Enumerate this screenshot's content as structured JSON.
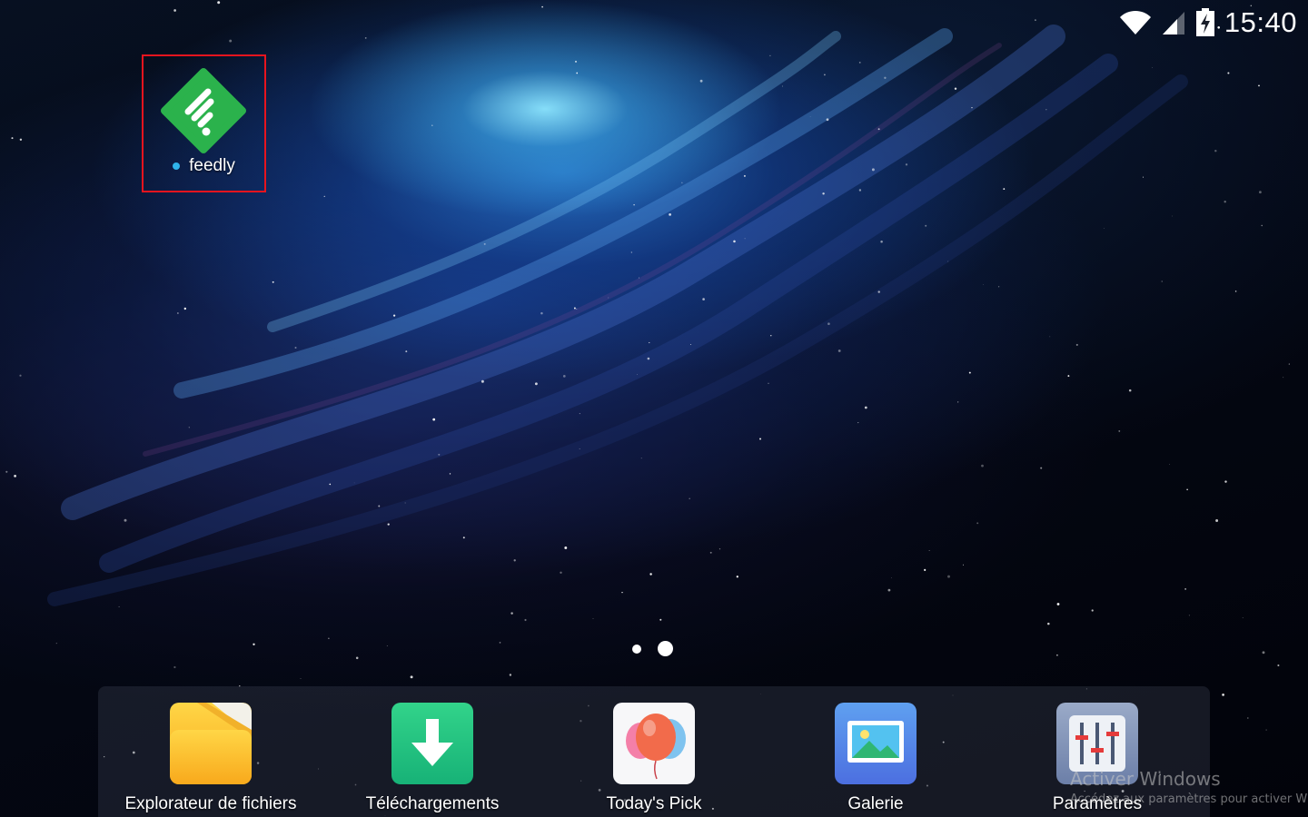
{
  "status_bar": {
    "time": "15:40",
    "icons": [
      "wifi-icon",
      "signal-icon",
      "battery-charging-icon"
    ]
  },
  "desktop": {
    "apps": [
      {
        "label": "feedly",
        "icon": "feedly-icon",
        "icon_color": "#2bb24c",
        "has_new_indicator": true,
        "highlighted": true
      }
    ]
  },
  "page_indicator": {
    "pages": 2,
    "current": 2
  },
  "dock": {
    "apps": [
      {
        "label": "Explorateur de fichiers",
        "icon": "folder-icon"
      },
      {
        "label": "Téléchargements",
        "icon": "download-icon"
      },
      {
        "label": "Today's Pick",
        "icon": "balloons-icon"
      },
      {
        "label": "Galerie",
        "icon": "gallery-icon"
      },
      {
        "label": "Paramètres",
        "icon": "settings-sliders-icon"
      }
    ]
  },
  "watermark": {
    "title": "Activer Windows",
    "subtitle": "Accédez aux paramètres pour activer W"
  },
  "colors": {
    "highlight_border": "#e8141e",
    "feedly_green": "#2bb24c",
    "indicator_blue": "#2fb3ea"
  }
}
